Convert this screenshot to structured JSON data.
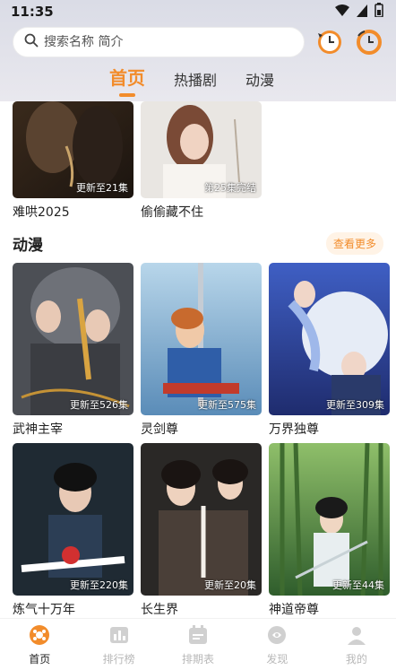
{
  "status": {
    "time": "11:35"
  },
  "search": {
    "placeholder": "搜索名称 简介"
  },
  "tabs": [
    {
      "label": "首页"
    },
    {
      "label": "热播剧"
    },
    {
      "label": "动漫"
    }
  ],
  "top_row": [
    {
      "title": "难哄2025",
      "badge": "更新至21集"
    },
    {
      "title": "偷偷藏不住",
      "badge": "第25集完结"
    }
  ],
  "section": {
    "title": "动漫",
    "more": "查看更多"
  },
  "anime": [
    {
      "title": "武神主宰",
      "badge": "更新至526集"
    },
    {
      "title": "灵剑尊",
      "badge": "更新至575集"
    },
    {
      "title": "万界独尊",
      "badge": "更新至309集"
    },
    {
      "title": "炼气十万年",
      "badge": "更新至220集"
    },
    {
      "title": "长生界",
      "badge": "更新至20集"
    },
    {
      "title": "神道帝尊",
      "badge": "更新至44集"
    }
  ],
  "nav": [
    {
      "label": "首页",
      "icon": "home-icon"
    },
    {
      "label": "排行榜",
      "icon": "ranking-icon"
    },
    {
      "label": "排期表",
      "icon": "schedule-icon"
    },
    {
      "label": "发现",
      "icon": "discover-icon"
    },
    {
      "label": "我的",
      "icon": "profile-icon"
    }
  ],
  "colors": {
    "accent": "#f28c2b",
    "header_bg": "#dfe0e8",
    "nav_inactive": "#b8b8b8"
  }
}
